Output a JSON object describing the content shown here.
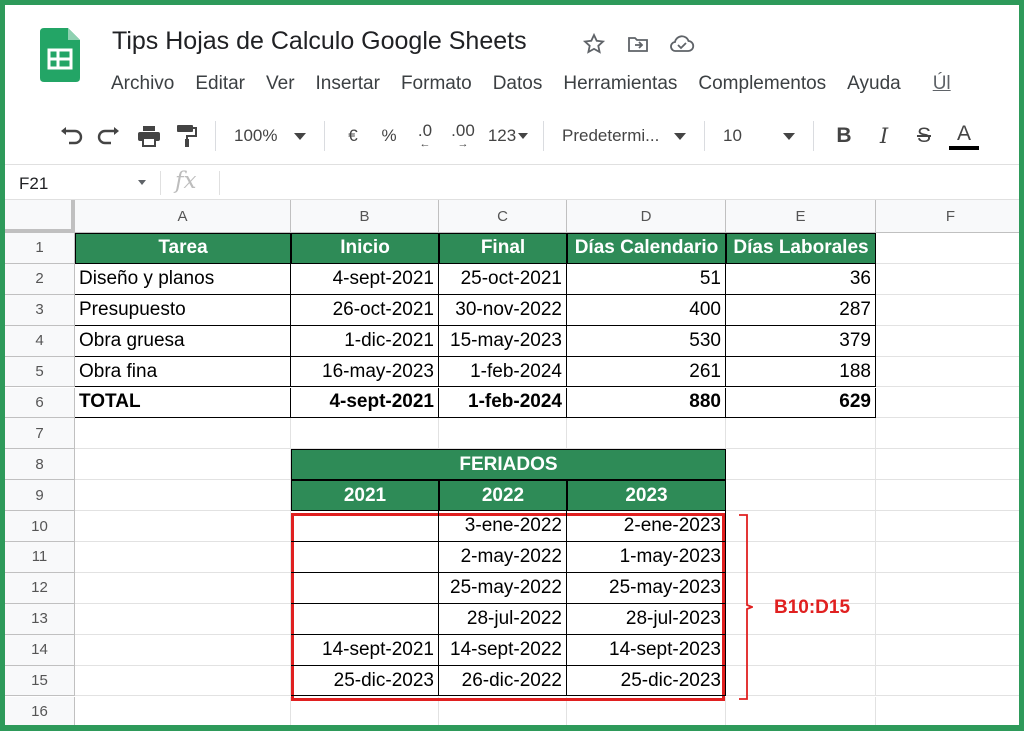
{
  "app": {
    "title": "Tips Hojas de Calculo Google Sheets",
    "menu": [
      "Archivo",
      "Editar",
      "Ver",
      "Insertar",
      "Formato",
      "Datos",
      "Herramientas",
      "Complementos",
      "Ayuda"
    ],
    "menu_last": "Úl"
  },
  "toolbar": {
    "zoom": "100%",
    "currency": "€",
    "percent": "%",
    "dec_less": ".0",
    "dec_more": ".00",
    "number_format": "123",
    "font": "Predetermi...",
    "font_size": "10",
    "bold": "B",
    "italic": "I",
    "strike": "S",
    "text_color": "A"
  },
  "formula_bar": {
    "cell_ref": "F21",
    "fx": "fx"
  },
  "columns": [
    "A",
    "B",
    "C",
    "D",
    "E",
    "F"
  ],
  "rows": [
    "1",
    "2",
    "3",
    "4",
    "5",
    "6",
    "7",
    "8",
    "9",
    "10",
    "11",
    "12",
    "13",
    "14",
    "15",
    "16"
  ],
  "tasks_table": {
    "headers": [
      "Tarea",
      "Inicio",
      "Final",
      "Días Calendario",
      "Días Laborales"
    ],
    "rows": [
      [
        "Diseño y planos",
        "4-sept-2021",
        "25-oct-2021",
        "51",
        "36"
      ],
      [
        "Presupuesto",
        "26-oct-2021",
        "30-nov-2022",
        "400",
        "287"
      ],
      [
        "Obra gruesa",
        "1-dic-2021",
        "15-may-2023",
        "530",
        "379"
      ],
      [
        "Obra fina",
        "16-may-2023",
        "1-feb-2024",
        "261",
        "188"
      ]
    ],
    "total": [
      "TOTAL",
      "4-sept-2021",
      "1-feb-2024",
      "880",
      "629"
    ]
  },
  "holidays_table": {
    "title": "FERIADOS",
    "years": [
      "2021",
      "2022",
      "2023"
    ],
    "rows": [
      [
        "",
        "3-ene-2022",
        "2-ene-2023"
      ],
      [
        "",
        "2-may-2022",
        "1-may-2023"
      ],
      [
        "",
        "25-may-2022",
        "25-may-2023"
      ],
      [
        "",
        "28-jul-2022",
        "28-jul-2023"
      ],
      [
        "14-sept-2021",
        "14-sept-2022",
        "14-sept-2023"
      ],
      [
        "25-dic-2023",
        "26-dic-2022",
        "25-dic-2023"
      ]
    ]
  },
  "annotation": {
    "range_label": "B10:D15"
  },
  "colors": {
    "header_green": "#2e8b57",
    "frame_green": "#2e9a5a",
    "highlight_red": "#e02020"
  }
}
